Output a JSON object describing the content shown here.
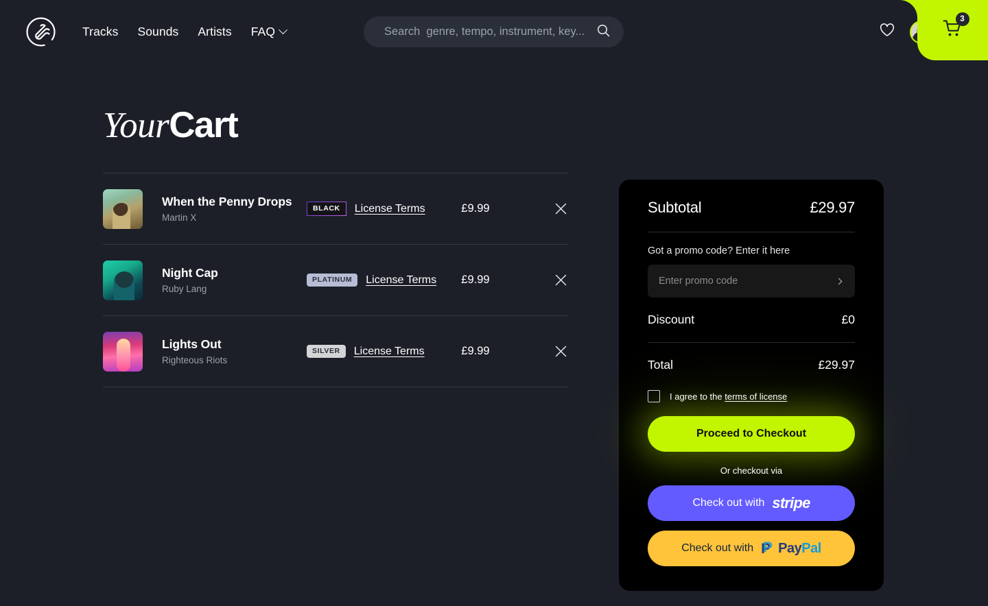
{
  "brand": {
    "logo_name": "sound-logo"
  },
  "nav": {
    "items": [
      {
        "label": "Tracks",
        "has_chevron": false
      },
      {
        "label": "Sounds",
        "has_chevron": false
      },
      {
        "label": "Artists",
        "has_chevron": false
      },
      {
        "label": "FAQ",
        "has_chevron": true
      }
    ]
  },
  "search": {
    "placeholder": "Search  genre, tempo, instrument, key...",
    "value": ""
  },
  "header": {
    "wishlist_icon": "heart-icon",
    "avatar_alt": "user-avatar",
    "account_chevron": "chevron-down-icon",
    "cart_icon": "shopping-cart-icon",
    "cart_count": "3"
  },
  "page": {
    "title_italic": "Your",
    "title_bold": "Cart"
  },
  "cart": {
    "items": [
      {
        "title": "When the Penny Drops",
        "artist": "Martin X",
        "badge": "BLACK",
        "badge_style": "black",
        "license_label": "License Terms",
        "price": "£9.99",
        "remove_icon": "close-icon"
      },
      {
        "title": "Night Cap",
        "artist": "Ruby Lang",
        "badge": "PLATINUM",
        "badge_style": "platinum",
        "license_label": "License Terms",
        "price": "£9.99",
        "remove_icon": "close-icon"
      },
      {
        "title": "Lights Out",
        "artist": "Righteous Riots",
        "badge": "SILVER",
        "badge_style": "silver",
        "license_label": "License Terms",
        "price": "£9.99",
        "remove_icon": "close-icon"
      }
    ]
  },
  "summary": {
    "subtotal_label": "Subtotal",
    "subtotal_value": "£29.97",
    "promo_prompt": "Got a promo code? Enter it here",
    "promo_placeholder": "Enter promo code",
    "promo_value": "",
    "promo_submit_icon": "chevron-right-icon",
    "discount_label": "Discount",
    "discount_value": "£0",
    "total_label": "Total",
    "total_value": "£29.97",
    "agree_text": "I agree to the ",
    "agree_link": "terms of license",
    "checkbox_checked": false,
    "checkout_label": "Proceed to Checkout",
    "or_label": "Or checkout via",
    "stripe_label": "Check out with",
    "stripe_brand": "stripe",
    "paypal_label": "Check out with",
    "paypal_brand_a": "Pay",
    "paypal_brand_b": "Pal"
  },
  "colors": {
    "accent_green": "#c2f500",
    "page_bg": "#1c1f28",
    "panel_bg": "#000000",
    "stripe_purple": "#635bff",
    "paypal_yellow": "#ffc439"
  }
}
